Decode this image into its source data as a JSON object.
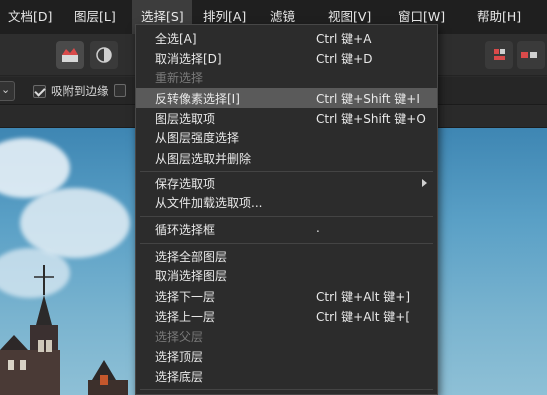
{
  "menubar": {
    "items": [
      {
        "label": "文档[D]"
      },
      {
        "label": "图层[L]"
      },
      {
        "label": "选择[S]"
      },
      {
        "label": "排列[A]"
      },
      {
        "label": "滤镜"
      },
      {
        "label": "视图[V]"
      },
      {
        "label": "窗口[W]"
      },
      {
        "label": "帮助[H]"
      }
    ],
    "active_index": 2
  },
  "context_bar": {
    "dropdown_arrow": "⌄",
    "snap_label": "吸附到边缘",
    "snap_checked": true
  },
  "select_menu": {
    "items": [
      {
        "label": "全选[A]",
        "shortcut": "Ctrl 键+A",
        "disabled": false,
        "highlighted": false
      },
      {
        "label": "取消选择[D]",
        "shortcut": "Ctrl 键+D",
        "disabled": false,
        "highlighted": false
      },
      {
        "label": "重新选择",
        "shortcut": "",
        "disabled": true,
        "highlighted": false
      },
      {
        "label": "反转像素选择[I]",
        "shortcut": "Ctrl 键+Shift 键+I",
        "disabled": false,
        "highlighted": true
      },
      {
        "label": "图层选取项",
        "shortcut": "Ctrl 键+Shift 键+O",
        "disabled": false,
        "highlighted": false
      },
      {
        "label": "从图层强度选择",
        "shortcut": "",
        "disabled": false,
        "highlighted": false
      },
      {
        "label": "从图层选取并删除",
        "shortcut": "",
        "disabled": false,
        "highlighted": false
      },
      {
        "label": "保存选取项",
        "shortcut": "",
        "disabled": false,
        "highlighted": false,
        "submenu": true
      },
      {
        "label": "从文件加载选取项...",
        "shortcut": "",
        "disabled": false,
        "highlighted": false
      },
      {
        "label": "循环选择框",
        "shortcut": ".",
        "disabled": false,
        "highlighted": false
      },
      {
        "label": "选择全部图层",
        "shortcut": "",
        "disabled": false,
        "highlighted": false
      },
      {
        "label": "取消选择图层",
        "shortcut": "",
        "disabled": false,
        "highlighted": false
      },
      {
        "label": "选择下一层",
        "shortcut": "Ctrl 键+Alt 键+]",
        "disabled": false,
        "highlighted": false
      },
      {
        "label": "选择上一层",
        "shortcut": "Ctrl 键+Alt 键+[",
        "disabled": false,
        "highlighted": false
      },
      {
        "label": "选择父层",
        "shortcut": "",
        "disabled": true,
        "highlighted": false
      },
      {
        "label": "选择顶层",
        "shortcut": "",
        "disabled": false,
        "highlighted": false
      },
      {
        "label": "选择底层",
        "shortcut": "",
        "disabled": false,
        "highlighted": false
      }
    ]
  },
  "colors": {
    "menubar_bg": "#1f1f1f",
    "menu_bg": "#2c2c2c",
    "highlight_bg": "#5a5a5a",
    "disabled_text": "#7a7a7a"
  }
}
